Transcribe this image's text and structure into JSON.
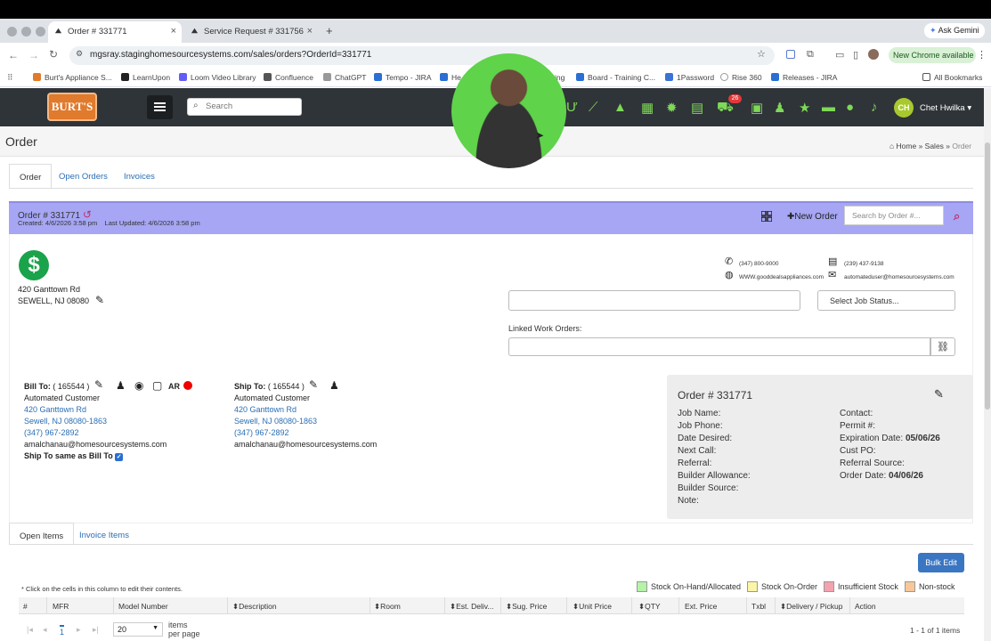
{
  "browser": {
    "tabs": [
      {
        "label": "Order # 331771",
        "active": true
      },
      {
        "label": "Service Request # 331756",
        "active": false
      }
    ],
    "new_tab": "+",
    "ask_gemini": "Ask Gemini",
    "url": "mgsray.staginghomesourcesystems.com/sales/orders?OrderId=331771",
    "new_chrome": "New Chrome available",
    "bookmarks": [
      "Burt's Appliance S...",
      "LearnUpon",
      "Loom Video Library",
      "Confluence",
      "ChatGPT",
      "Tempo - JIRA",
      "He",
      "ing",
      "Board - Training C...",
      "1Password",
      "Rise 360",
      "Releases - JIRA"
    ],
    "all_bookmarks": "All Bookmarks"
  },
  "app": {
    "logo": "BURT'S",
    "search_placeholder": "Search",
    "cart_count": "26",
    "user_initials": "CH",
    "user_name": "Chet Hwilka",
    "page_title": "Order",
    "breadcrumb": [
      "Home",
      "Sales",
      "Order"
    ]
  },
  "tabs": [
    "Order",
    "Open Orders",
    "Invoices"
  ],
  "order": {
    "number": "Order # 331771",
    "meta": "Created: 4/6/2026 3:58 pm    Last Updated: 4/6/2026 3:58 pm",
    "new_order": "New Order",
    "search_placeholder": "Search by Order #...",
    "address1": "420 Ganttown Rd",
    "address2": "SEWELL, NJ 08080",
    "phone1": "(347) 800-9000",
    "fax": "(239) 437-9138",
    "website": "WWW.gooddealsappliances.com",
    "email": "automateduser@homesourcesystems.com",
    "job_status": "Select Job Status...",
    "linked_wo_label": "Linked Work Orders:"
  },
  "bill_to": {
    "heading": "Bill To:",
    "id": "( 165544 )",
    "ar": "AR",
    "name": "Automated Customer",
    "street": "420 Ganttown Rd",
    "city": "Sewell, NJ 08080-1863",
    "phone": "(347) 967-2892",
    "email": "amalchanau@homesourcesystems.com",
    "same": "Ship To same as Bill To"
  },
  "ship_to": {
    "heading": "Ship To:",
    "id": "( 165544 )",
    "name": "Automated Customer",
    "street": "420 Ganttown Rd",
    "city": "Sewell, NJ 08080-1863",
    "phone": "(347) 967-2892",
    "email": "amalchanau@homesourcesystems.com"
  },
  "card": {
    "title": "Order # 331771",
    "left": [
      "Job Name:",
      "Job Phone:",
      "Date Desired:",
      "Next Call:",
      "Referral:",
      "Builder Allowance:",
      "Builder Source:",
      "Note:"
    ],
    "right_labels": [
      "Contact:",
      "Permit #:",
      "Expiration Date:",
      "Cust PO:",
      "Referral Source:",
      "Order Date:"
    ],
    "right_values": [
      "",
      "",
      "05/06/26",
      "",
      "",
      "04/06/26"
    ]
  },
  "items": {
    "tabs": [
      "Open Items",
      "Invoice Items"
    ],
    "bulk_edit": "Bulk Edit",
    "note": "* Click on the cells in this column to edit their contents.",
    "legend": [
      {
        "label": "Stock On-Hand/Allocated",
        "color": "#b6f2a8"
      },
      {
        "label": "Stock On-Order",
        "color": "#fbf5a8"
      },
      {
        "label": "Insufficient Stock",
        "color": "#f3a3b0"
      },
      {
        "label": "Non-stock",
        "color": "#f7c79a"
      }
    ],
    "columns": [
      "#",
      "MFR",
      "Model Number",
      "Description",
      "Room",
      "Est. Deliv...",
      "Sug. Price",
      "Unit Price",
      "QTY",
      "Ext. Price",
      "Txbl",
      "Delivery / Pickup",
      "Action"
    ],
    "page": "1",
    "per_page": "20",
    "items_label": "items",
    "per_page_label": "per page",
    "range": "1 - 1 of 1 items"
  }
}
